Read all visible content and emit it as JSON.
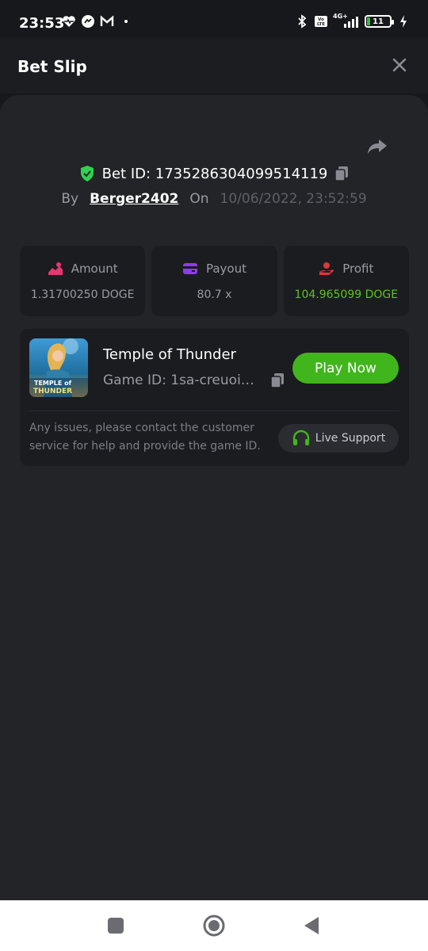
{
  "status_bar": {
    "time": "23:53",
    "left_icons": [
      "heart-monitor-icon",
      "messenger-icon",
      "gmail-icon",
      "dot-icon"
    ],
    "right_icons": [
      "bluetooth-icon",
      "volte-icon",
      "signal-4g-icon",
      "battery-icon",
      "charging-icon"
    ],
    "network_label": "4G+",
    "volte_label": "Vo LTE",
    "battery_level": "11"
  },
  "header": {
    "title": "Bet Slip",
    "close_icon": "close-icon"
  },
  "bet": {
    "id_text": "Bet ID: 1735286304099514119",
    "by_label": "By",
    "user": "Berger2402",
    "on_label": "On",
    "date": "10/06/2022, 23:52:59"
  },
  "stats": [
    {
      "label": "Amount",
      "value": "1.31700250 DOGE",
      "icon": "amount-icon",
      "icon_color": "#e8366f"
    },
    {
      "label": "Payout",
      "value": "80.7 x",
      "icon": "wallet-icon",
      "icon_color": "#8a3df0"
    },
    {
      "label": "Profit",
      "value": "104.965099 DOGE",
      "icon": "profit-icon",
      "icon_color": "#e0363a"
    }
  ],
  "game": {
    "name": "Temple of Thunder",
    "id_text": "Game ID: 1sa-creuoig...",
    "thumb_text_1": "TEMPLE of",
    "thumb_text_2": "THUNDER",
    "play_label": "Play Now",
    "help_text": "Any issues, please contact the customer service for help and provide the game ID.",
    "support_label": "Live Support"
  },
  "colors": {
    "accent_green": "#41b51c",
    "profit_green": "#5cc41f",
    "shield_green": "#2fd24f"
  }
}
